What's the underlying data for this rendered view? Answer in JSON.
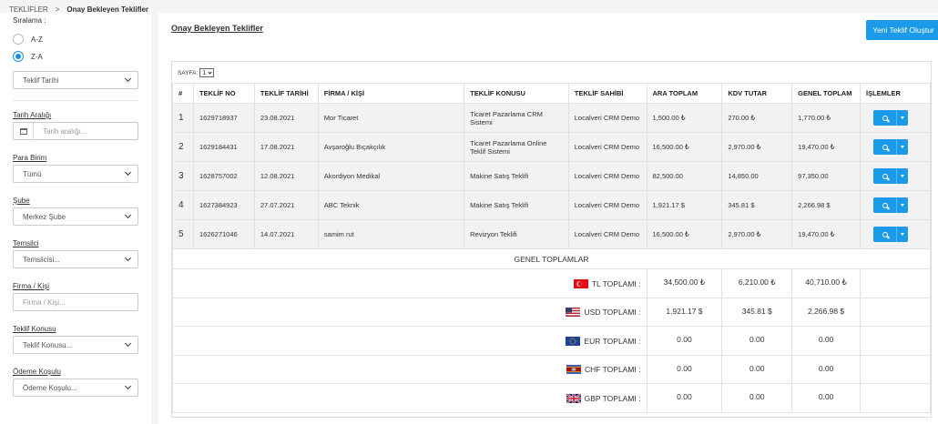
{
  "breadcrumb": {
    "root": "TEKLİFLER",
    "separator": ">",
    "current": "Onay Bekleyen Teklifler"
  },
  "sidebar": {
    "sort_title": "Sıralama :",
    "sort_options": [
      {
        "label": "A-Z",
        "selected": false
      },
      {
        "label": "Z-A",
        "selected": true
      }
    ],
    "sort_field": "Teklif Tarihi",
    "date_range_label": "Tarih Aralığı",
    "date_range_placeholder": "Tarih aralığı...",
    "currency_label": "Para Birim",
    "currency_value": "Tümü",
    "branch_label": "Şube",
    "branch_value": "Merkez Şube",
    "rep_label": "Temsilci",
    "rep_value": "Temsilcisi...",
    "company_label": "Firma / Kişi",
    "company_placeholder": "Firma / Kişi...",
    "subject_label": "Teklif Konusu",
    "subject_value": "Teklif Konusu...",
    "payment_label": "Ödeme Koşulu",
    "payment_value": "Ödeme Koşulu..."
  },
  "main": {
    "title": "Onay Bekleyen Teklifler",
    "new_button": "Yeni Teklif Oluştur",
    "pager_label": "SAYFA:",
    "pager_value": "1",
    "columns": [
      "#",
      "TEKLİF NO",
      "TEKLİF TARİHİ",
      "FİRMA / KİŞİ",
      "TEKLİF KONUSU",
      "TEKLİF SAHİBİ",
      "ARA TOPLAM",
      "KDV TUTAR",
      "GENEL TOPLAM",
      "İŞLEMLER"
    ],
    "rows": [
      {
        "n": "1",
        "no": "1629718937",
        "date": "23.08.2021",
        "company": "Mor Ticaret",
        "subject": "Ticaret Pazarlama CRM Sistemi",
        "owner": "Localveri CRM Demo",
        "subtotal": "1,500.00 ₺",
        "tax": "270.00 ₺",
        "total": "1,770.00 ₺"
      },
      {
        "n": "2",
        "no": "1629184431",
        "date": "17.08.2021",
        "company": "Avşaroğlu Bıçakçılık",
        "subject": "Ticaret Pazarlama Online Teklif Sistemi",
        "owner": "Localveri CRM Demo",
        "subtotal": "16,500.00 ₺",
        "tax": "2,970.00 ₺",
        "total": "19,470.00 ₺"
      },
      {
        "n": "3",
        "no": "1628757002",
        "date": "12.08.2021",
        "company": "Akordiyon Medikal",
        "subject": "Makine Satış Teklifi",
        "owner": "Localveri CRM Demo",
        "subtotal": "82,500.00",
        "tax": "14,850.00",
        "total": "97,350.00"
      },
      {
        "n": "4",
        "no": "1627384923",
        "date": "27.07.2021",
        "company": "ABC Teknik",
        "subject": "Makine Satış Teklifi",
        "owner": "Localveri CRM Demo",
        "subtotal": "1,921.17 $",
        "tax": "345.81 $",
        "total": "2,266.98 $"
      },
      {
        "n": "5",
        "no": "1626271046",
        "date": "14.07.2021",
        "company": "samim rut",
        "subject": "Revizyon Teklifi",
        "owner": "Localveri CRM Demo",
        "subtotal": "16,500.00 ₺",
        "tax": "2,970.00 ₺",
        "total": "19,470.00 ₺"
      }
    ],
    "totals_title": "GENEL TOPLAMLAR",
    "totals": [
      {
        "label": "TL TOPLAMI :",
        "flag": "turkey-flag-icon",
        "subtotal": "34,500.00 ₺",
        "tax": "6,210.00 ₺",
        "total": "40,710.00 ₺"
      },
      {
        "label": "USD TOPLAMI :",
        "flag": "usa-flag-icon",
        "subtotal": "1,921.17 $",
        "tax": "345.81 $",
        "total": "2,266.98 $"
      },
      {
        "label": "EUR TOPLAMI :",
        "flag": "eu-flag-icon",
        "subtotal": "0.00",
        "tax": "0.00",
        "total": "0.00"
      },
      {
        "label": "CHF TOPLAMI :",
        "flag": "swaziland-flag-icon",
        "subtotal": "0.00",
        "tax": "0.00",
        "total": "0.00"
      },
      {
        "label": "GBP TOPLAMI :",
        "flag": "uk-flag-icon",
        "subtotal": "0.00",
        "tax": "0.00",
        "total": "0.00"
      }
    ]
  },
  "colors": {
    "accent": "#1a9ae8",
    "row_bg": "#f2f2f2",
    "page_bg": "#f4f4f5"
  }
}
